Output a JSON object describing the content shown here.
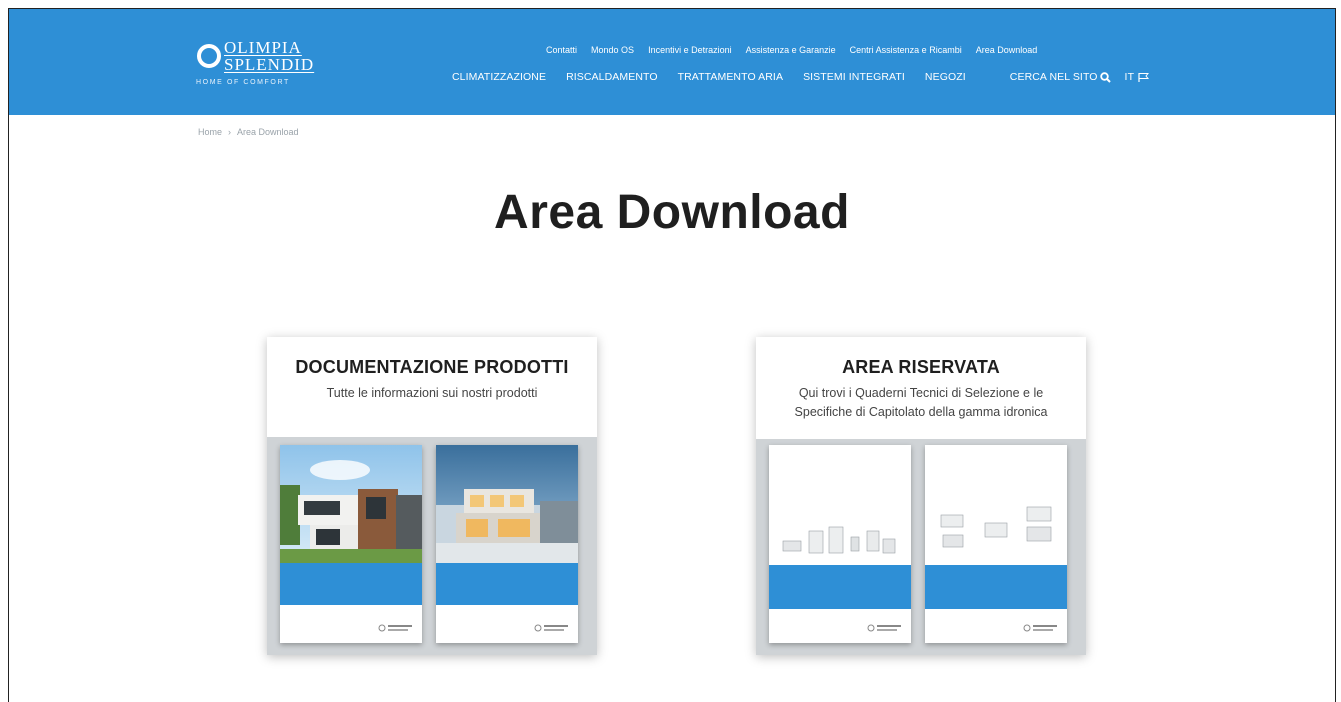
{
  "brand": {
    "line1": "OLIMPIA",
    "line2": "SPLENDID",
    "tagline": "HOME OF COMFORT"
  },
  "top_nav": [
    "Contatti",
    "Mondo OS",
    "Incentivi e Detrazioni",
    "Assistenza e Garanzie",
    "Centri Assistenza e Ricambi",
    "Area Download"
  ],
  "main_nav": [
    "CLIMATIZZAZIONE",
    "RISCALDAMENTO",
    "TRATTAMENTO ARIA",
    "SISTEMI INTEGRATI",
    "NEGOZI"
  ],
  "search_label": "CERCA NEL SITO",
  "lang_label": "IT",
  "breadcrumb": {
    "home": "Home",
    "sep": "›",
    "current": "Area Download"
  },
  "page_title": "Area Download",
  "cards": [
    {
      "title": "DOCUMENTAZIONE PRODOTTI",
      "subtitle": "Tutte le informazioni sui nostri prodotti"
    },
    {
      "title": "AREA RISERVATA",
      "subtitle": "Qui trovi i Quaderni Tecnici di Selezione e le Specifiche di Capitolato della gamma idronica"
    }
  ],
  "colors": {
    "header_blue": "#2e8fd6",
    "card_bg": "#cfd3d6",
    "title_text": "#1f1f1f"
  }
}
